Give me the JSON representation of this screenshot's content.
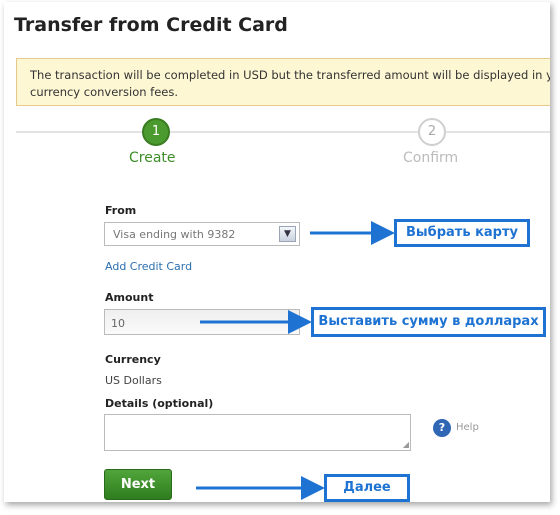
{
  "page": {
    "title": "Transfer from Credit Card"
  },
  "notice": {
    "line1": "The transaction will be completed in USD but the transferred amount will be displayed in your bank a",
    "line2": "currency conversion fees."
  },
  "steps": [
    {
      "number": "1",
      "label": "Create",
      "state": "active"
    },
    {
      "number": "2",
      "label": "Confirm",
      "state": "inactive"
    }
  ],
  "form": {
    "from_label": "From",
    "from_value": "Visa ending with 9382",
    "add_card_link": "Add Credit Card",
    "amount_label": "Amount",
    "amount_value": "10",
    "currency_label": "Currency",
    "currency_value": "US Dollars",
    "details_label": "Details (optional)",
    "details_value": "",
    "help_icon": "?",
    "help_label": "Help",
    "next_label": "Next"
  },
  "annotations": {
    "select_card": "Выбрать карту",
    "set_amount": "Выставить сумму в долларах",
    "next": "Далее"
  },
  "colors": {
    "accent_green": "#3e8e2a",
    "callout_blue": "#1e73d2",
    "link_blue": "#2a6fb0",
    "notice_bg": "#fdf7d4"
  }
}
